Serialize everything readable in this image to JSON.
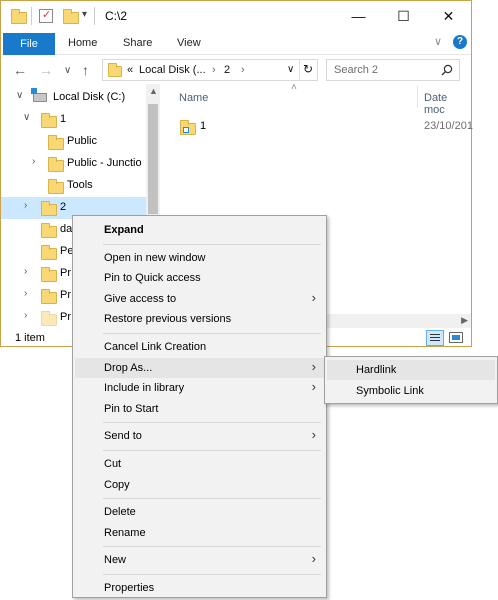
{
  "window": {
    "title": "C:\\2",
    "minimize": "—",
    "maximize": "☐",
    "close": "✕"
  },
  "ribbon": {
    "tabs": [
      "File",
      "Home",
      "Share",
      "View"
    ],
    "expand_chevron": "∨",
    "help": "?"
  },
  "address": {
    "back": "←",
    "forward": "→",
    "recent": "∨",
    "up": "↑",
    "overflow": "«",
    "crumbs": [
      "Local Disk (...",
      "2"
    ],
    "separator": "›",
    "dropdown": "∨",
    "refresh": "↻"
  },
  "search": {
    "placeholder": "Search 2",
    "icon": "search-icon"
  },
  "tree": [
    {
      "label": "Local Disk (C:)",
      "expanded": true,
      "icon": "drive-icon"
    },
    {
      "label": "1",
      "expanded": true,
      "icon": "folder-icon"
    },
    {
      "label": "Public",
      "icon": "folder-icon"
    },
    {
      "label": "Public - Junctio",
      "icon": "junction-folder-icon",
      "has_children": true
    },
    {
      "label": "Tools",
      "icon": "folder-icon"
    },
    {
      "label": "2",
      "icon": "folder-icon",
      "selected": true,
      "has_children": true
    },
    {
      "label": "da",
      "icon": "folder-icon"
    },
    {
      "label": "Pe",
      "icon": "folder-icon"
    },
    {
      "label": "Pr",
      "icon": "folder-icon",
      "has_children": true
    },
    {
      "label": "Pr",
      "icon": "folder-icon",
      "has_children": true
    },
    {
      "label": "Pr",
      "icon": "folder-icon",
      "has_children": true
    }
  ],
  "content": {
    "columns": [
      "Name",
      "Date moc"
    ],
    "sort_indicator": "˄",
    "rows": [
      {
        "name": "1",
        "date": "23/10/201",
        "icon": "link-folder-icon"
      }
    ]
  },
  "status": {
    "count": "1 item"
  },
  "context_menu": {
    "items": [
      {
        "label": "Expand",
        "bold": true
      },
      {
        "sep": true
      },
      {
        "label": "Open in new window"
      },
      {
        "label": "Pin to Quick access"
      },
      {
        "label": "Give access to",
        "submenu": true
      },
      {
        "label": "Restore previous versions"
      },
      {
        "sep": true
      },
      {
        "label": "Cancel Link Creation"
      },
      {
        "label": "Drop As...",
        "submenu": true,
        "highlight": true
      },
      {
        "label": "Include in library",
        "submenu": true
      },
      {
        "label": "Pin to Start"
      },
      {
        "sep": true
      },
      {
        "label": "Send to",
        "submenu": true
      },
      {
        "sep": true
      },
      {
        "label": "Cut"
      },
      {
        "label": "Copy"
      },
      {
        "sep": true
      },
      {
        "label": "Delete"
      },
      {
        "label": "Rename"
      },
      {
        "sep": true
      },
      {
        "label": "New",
        "submenu": true
      },
      {
        "sep": true
      },
      {
        "label": "Properties"
      }
    ],
    "submenu_glyph": "›"
  },
  "drop_as_submenu": {
    "items": [
      "Hardlink",
      "Symbolic Link"
    ]
  }
}
